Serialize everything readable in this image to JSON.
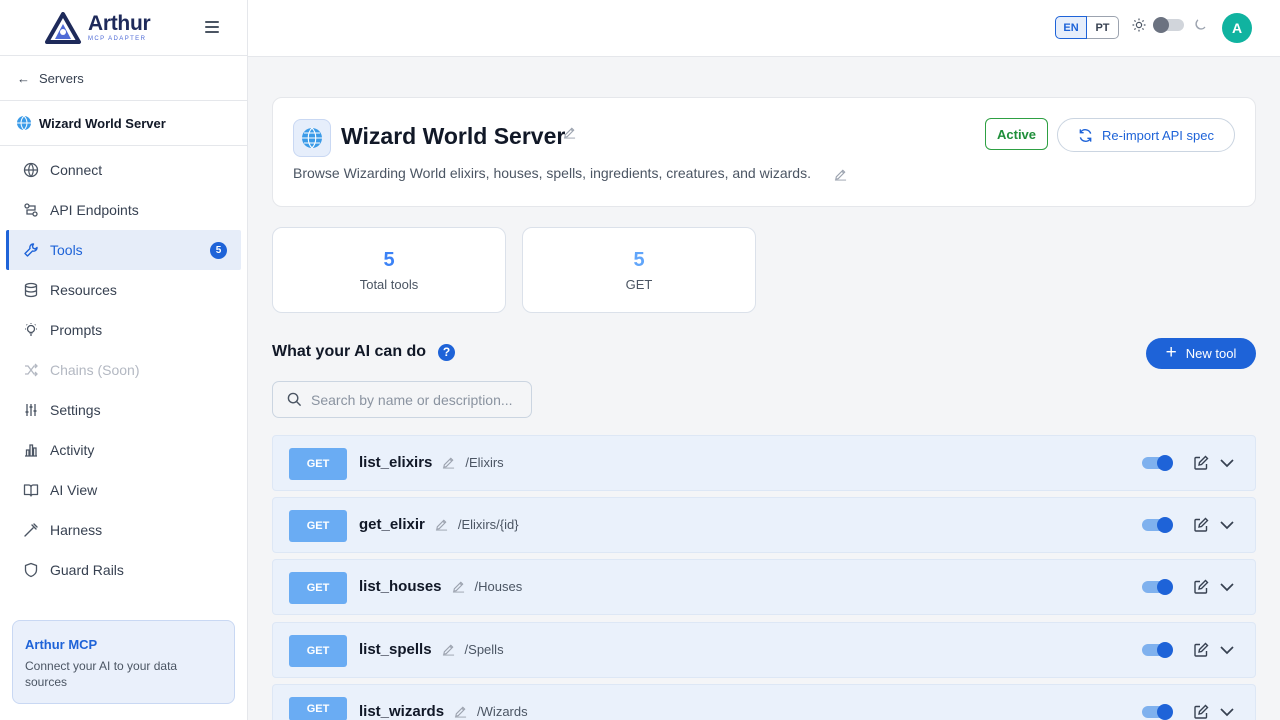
{
  "brand": {
    "name": "Arthur",
    "subtitle": "MCP ADAPTER"
  },
  "sidebar": {
    "back_label": "Servers",
    "server_name": "Wizard World Server",
    "items": [
      {
        "label": "Connect",
        "icon": "globe-icon"
      },
      {
        "label": "API Endpoints",
        "icon": "endpoints-icon"
      },
      {
        "label": "Tools",
        "icon": "wrench-icon",
        "badge": "5",
        "active": true
      },
      {
        "label": "Resources",
        "icon": "database-icon"
      },
      {
        "label": "Prompts",
        "icon": "lightbulb-icon"
      },
      {
        "label": "Chains (Soon)",
        "icon": "shuffle-icon",
        "disabled": true
      },
      {
        "label": "Settings",
        "icon": "sliders-icon"
      },
      {
        "label": "Activity",
        "icon": "bar-chart-icon"
      },
      {
        "label": "AI View",
        "icon": "book-icon"
      },
      {
        "label": "Harness",
        "icon": "harness-icon"
      },
      {
        "label": "Guard Rails",
        "icon": "shield-icon"
      }
    ],
    "promo": {
      "title": "Arthur MCP",
      "text": "Connect your AI to your data sources"
    }
  },
  "topbar": {
    "lang_active": "EN",
    "lang_other": "PT",
    "avatar_initial": "A"
  },
  "server": {
    "title": "Wizard World Server",
    "description": "Browse Wizarding World elixirs, houses, spells, ingredients, creatures, and wizards.",
    "status": "Active",
    "reimport_label": "Re-import API spec"
  },
  "stats": [
    {
      "value": "5",
      "label": "Total tools"
    },
    {
      "value": "5",
      "label": "GET"
    }
  ],
  "tools_section": {
    "title": "What your AI can do",
    "help": "?",
    "new_tool_label": "New tool",
    "search_placeholder": "Search by name or description..."
  },
  "tools": [
    {
      "method": "GET",
      "name": "list_elixirs",
      "path": "/Elixirs",
      "enabled": true
    },
    {
      "method": "GET",
      "name": "get_elixir",
      "path": "/Elixirs/{id}",
      "enabled": true
    },
    {
      "method": "GET",
      "name": "list_houses",
      "path": "/Houses",
      "enabled": true
    },
    {
      "method": "GET",
      "name": "list_spells",
      "path": "/Spells",
      "enabled": true
    },
    {
      "method": "GET",
      "name": "list_wizards",
      "path": "/Wizards",
      "enabled": true
    }
  ],
  "colors": {
    "accent": "#1e63d8",
    "method_badge": "#6aacf3",
    "active_status": "#1f8f3a",
    "avatar": "#10b3a0"
  }
}
